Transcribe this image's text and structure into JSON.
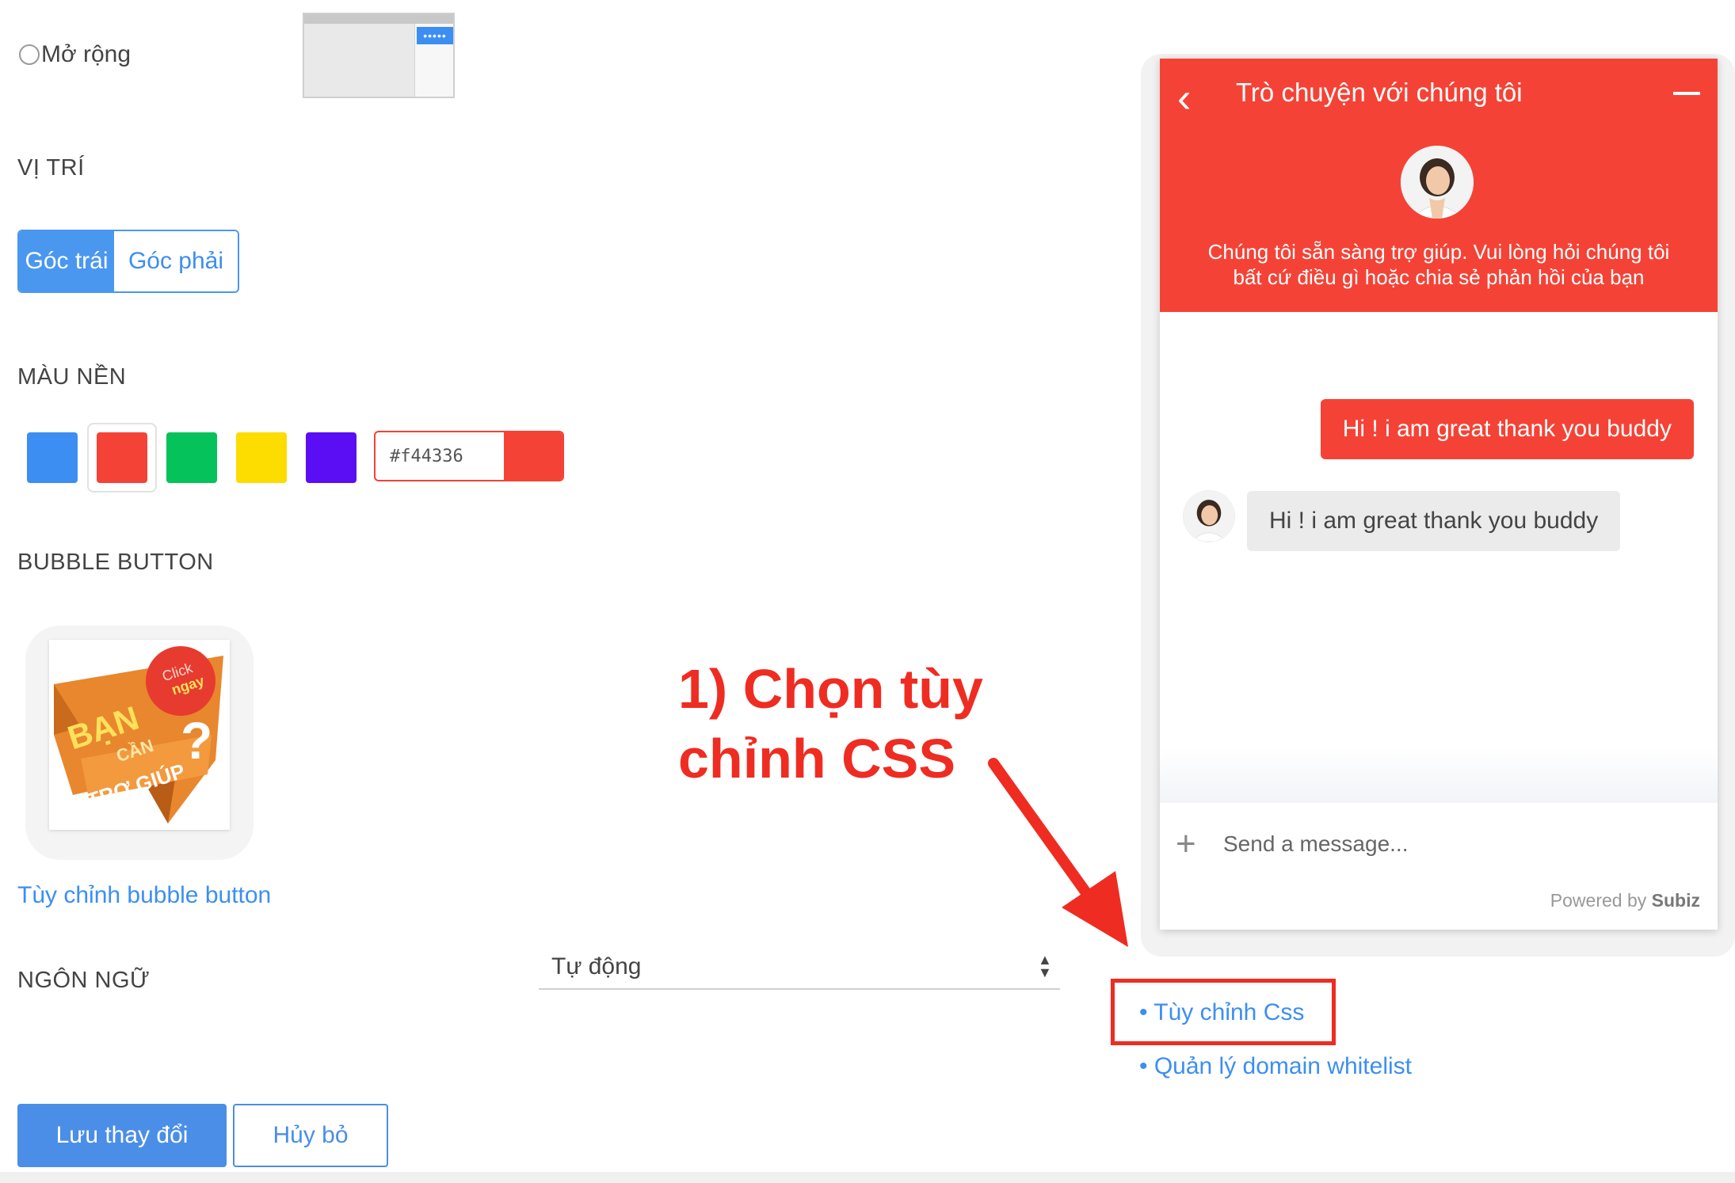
{
  "layout_option": {
    "label": "Mở rộng",
    "thumb_dots": "•••••"
  },
  "position": {
    "label": "VỊ TRÍ",
    "options": [
      {
        "label": "Góc trái",
        "active": true
      },
      {
        "label": "Góc phải",
        "active": false
      }
    ]
  },
  "background": {
    "label": "MÀU NỀN",
    "swatches": [
      "#3c8ef3",
      "#f44336",
      "#05c35a",
      "#fddc00",
      "#5b0ef3"
    ],
    "selected": "#f44336",
    "hex_value": "#f44336"
  },
  "bubble": {
    "label": "BUBBLE BUTTON",
    "image_text": {
      "badge_1": "Click",
      "badge_2": "ngay",
      "line_1": "BẠN",
      "line_2": "CẦN",
      "line_3": "TRỢ GIÚP",
      "question": "?"
    },
    "customize_link": "Tùy chỉnh bubble button"
  },
  "language": {
    "label": "NGÔN NGỮ",
    "value": "Tự động"
  },
  "actions": {
    "save": "Lưu thay đổi",
    "cancel": "Hủy bỏ"
  },
  "annotation": {
    "line1": "1) Chọn tùy",
    "line2": "chỉnh CSS",
    "color": "#ef2c22"
  },
  "side_links": {
    "custom_css": "• Tùy chỉnh Css",
    "domain_whitelist": "• Quản lý domain whitelist"
  },
  "chat_widget": {
    "title": "Trò chuyện với chúng tôi",
    "intro": "Chúng tôi sẵn sàng trợ giúp. Vui lòng hỏi chúng tôi bất cứ điều gì hoặc chia sẻ phản hồi của bạn",
    "messages": [
      {
        "from": "visitor",
        "text": "Hi ! i am great thank you buddy"
      },
      {
        "from": "agent",
        "text": "Hi ! i am great thank you buddy"
      }
    ],
    "input_placeholder": "Send a message...",
    "powered_prefix": "Powered by",
    "powered_brand": "Subiz",
    "header_color": "#f44336"
  }
}
